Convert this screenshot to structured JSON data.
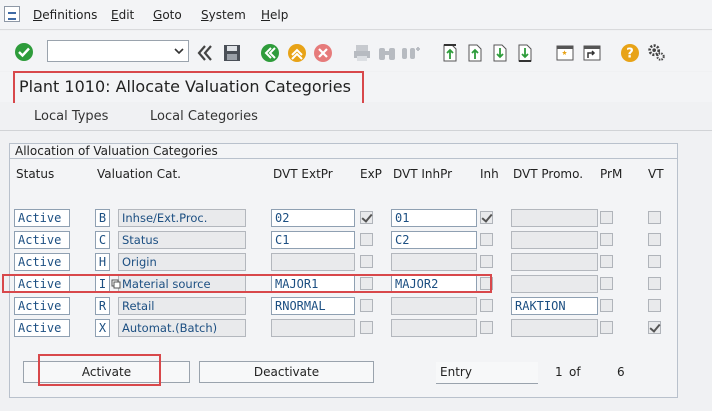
{
  "menu": [
    "Definitions",
    "Edit",
    "Goto",
    "System",
    "Help"
  ],
  "command_field": {
    "value": ""
  },
  "title": "Plant 1010: Allocate Valuation Categories",
  "tabs": [
    "Local Types",
    "Local Categories"
  ],
  "group_title": "Allocation of Valuation Categories",
  "columns": [
    "Status",
    "Valuation Cat.",
    "DVT ExtPr",
    "ExP",
    "DVT InhPr",
    "Inh",
    "DVT Promo.",
    "PrM",
    "VT"
  ],
  "rows": [
    {
      "status": "Active",
      "key": "B",
      "name": "Inhse/Ext.Proc.",
      "dvt_ext": "02",
      "exp": true,
      "dvt_inh": "01",
      "inh": true,
      "dvt_promo": "",
      "prm": false,
      "vt": false
    },
    {
      "status": "Active",
      "key": "C",
      "name": "Status",
      "dvt_ext": "C1",
      "exp": false,
      "dvt_inh": "C2",
      "inh": false,
      "dvt_promo": "",
      "prm": false,
      "vt": false
    },
    {
      "status": "Active",
      "key": "H",
      "name": "Origin",
      "dvt_ext": "",
      "exp": false,
      "dvt_inh": "",
      "inh": false,
      "dvt_promo": "",
      "prm": false,
      "vt": false
    },
    {
      "status": "Active",
      "key": "I",
      "name": "Material source",
      "dvt_ext": "MAJOR1",
      "exp": false,
      "dvt_inh": "MAJOR2",
      "inh": false,
      "dvt_promo": "",
      "prm": false,
      "vt": false
    },
    {
      "status": "Active",
      "key": "R",
      "name": "Retail",
      "dvt_ext": "RNORMAL",
      "exp": false,
      "dvt_inh": "",
      "inh": false,
      "dvt_promo": "RAKTION",
      "prm": false,
      "vt": false
    },
    {
      "status": "Active",
      "key": "X",
      "name": "Automat.(Batch)",
      "dvt_ext": "",
      "exp": false,
      "dvt_inh": "",
      "inh": false,
      "dvt_promo": "",
      "prm": false,
      "vt": true
    }
  ],
  "buttons": {
    "activate": "Activate",
    "deactivate": "Deactivate",
    "entry": "Entry"
  },
  "pager": {
    "current": "1",
    "of": "of",
    "total": "6"
  },
  "colors": {
    "highlight": "#d8484b",
    "field_text": "#1c4f82",
    "ok_green": "#2e9c3b"
  }
}
